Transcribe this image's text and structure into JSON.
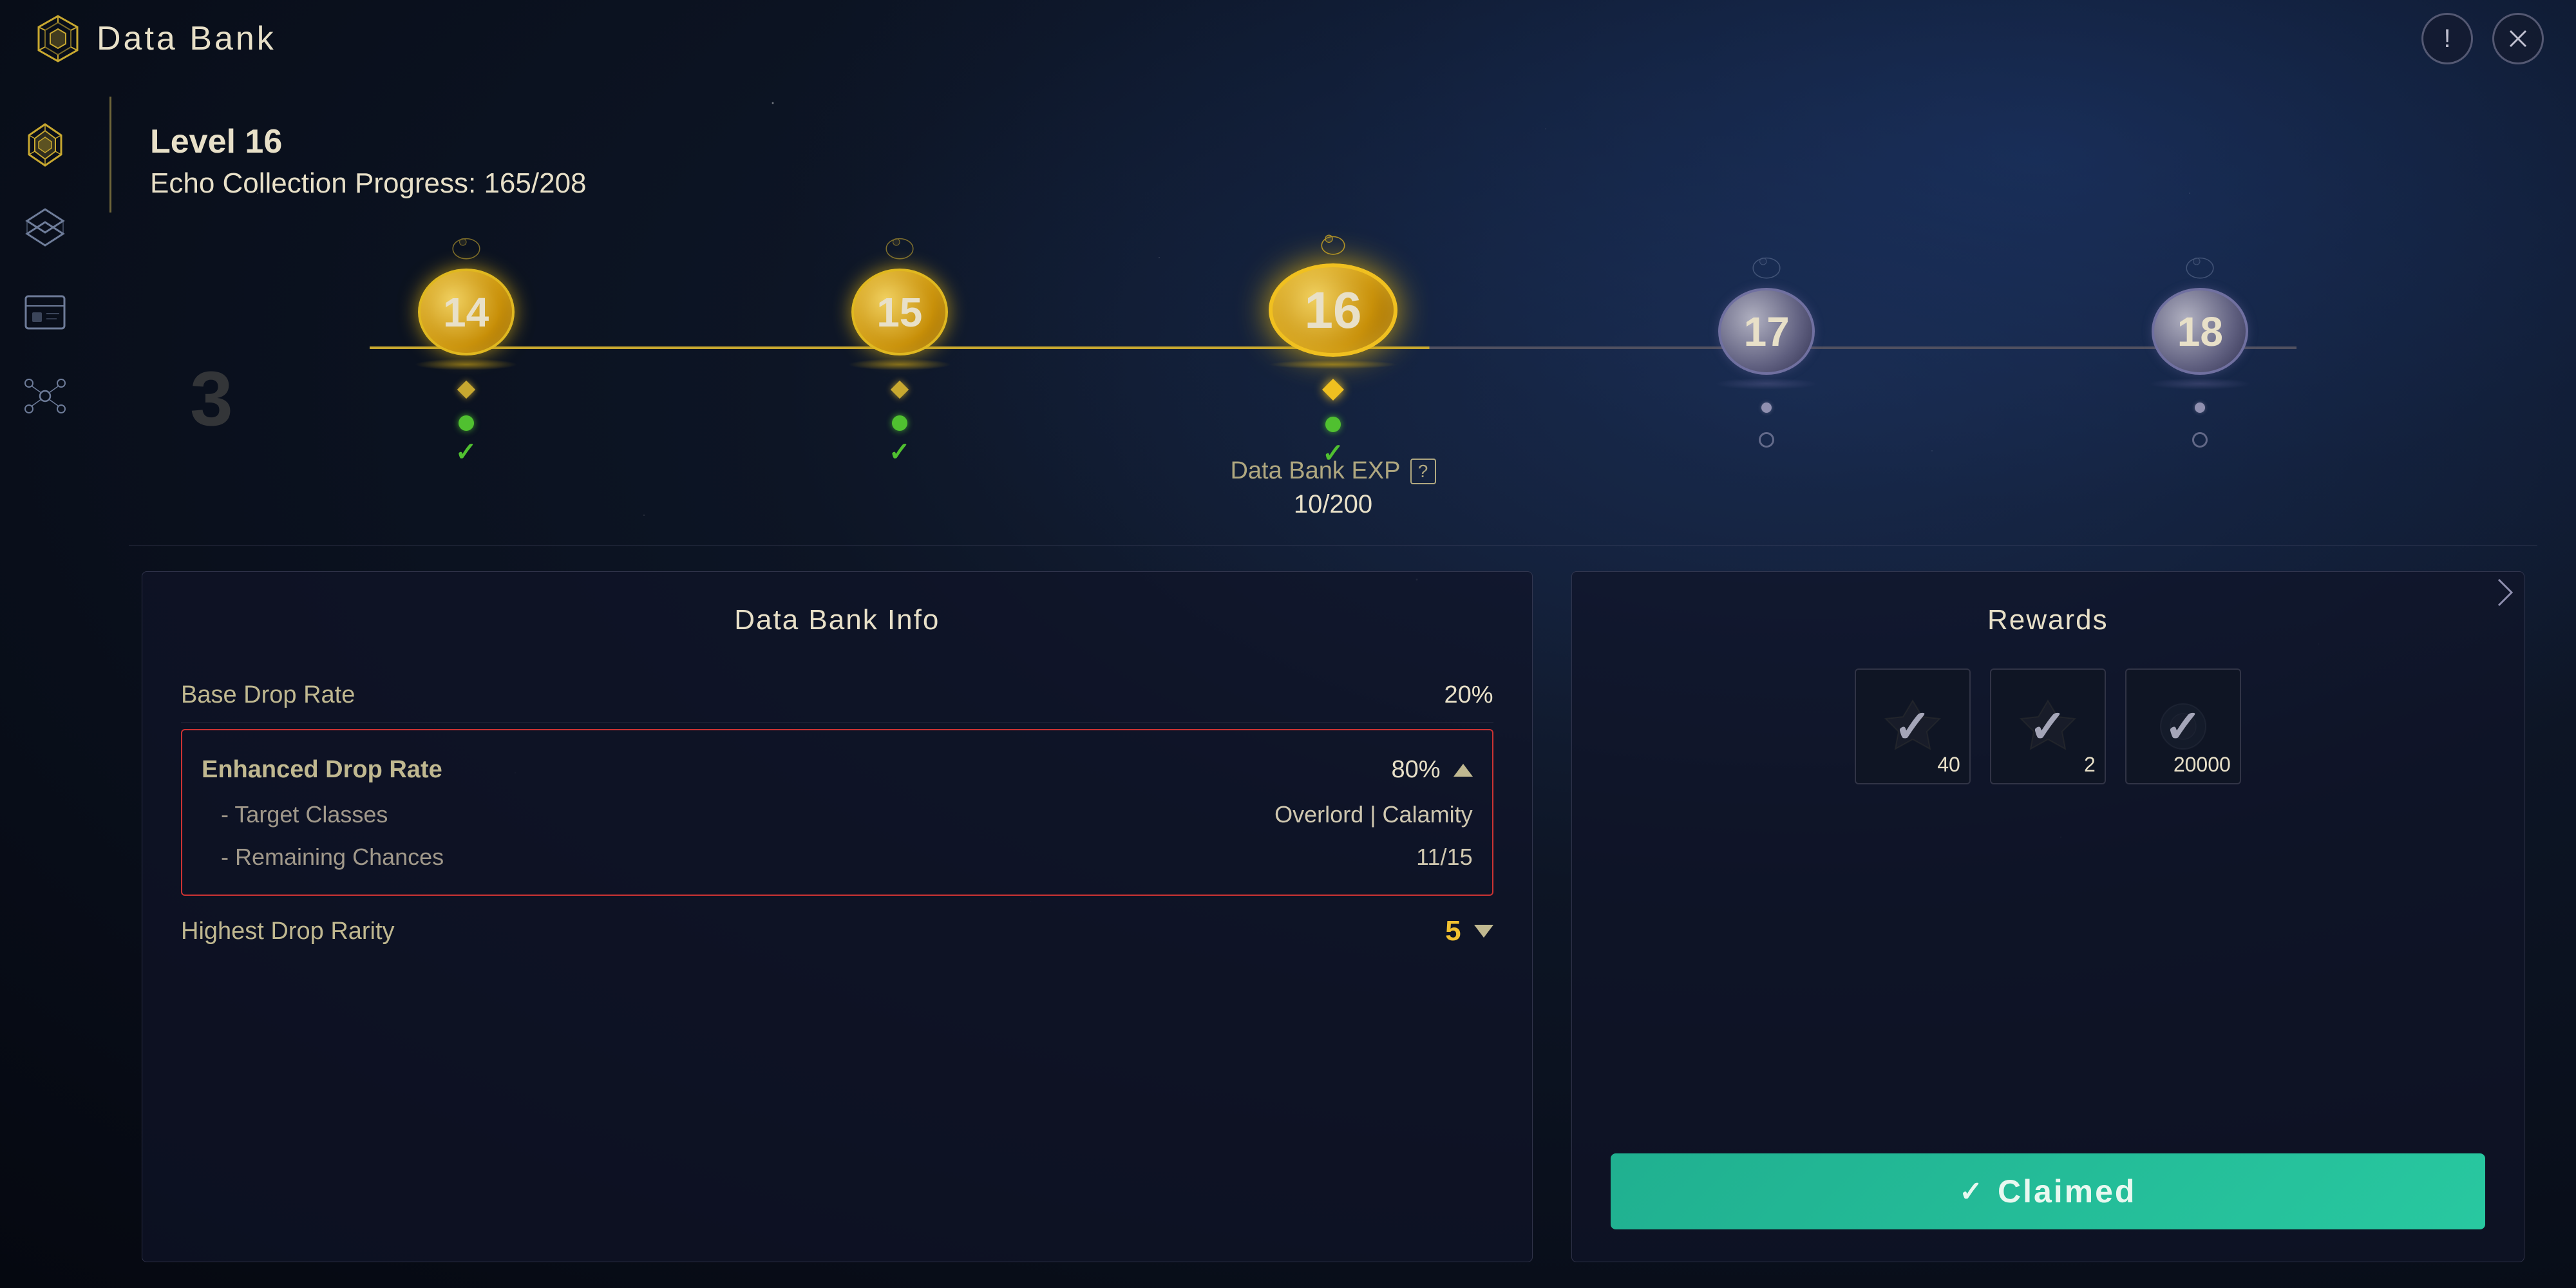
{
  "app": {
    "title": "Data Bank",
    "close_label": "×",
    "info_label": "!"
  },
  "level": {
    "current": "Level 16",
    "progress_label": "Echo Collection Progress: 165/208"
  },
  "milestones": [
    {
      "number": "14",
      "type": "gold",
      "claimed": true
    },
    {
      "number": "15",
      "type": "gold",
      "claimed": true
    },
    {
      "number": "16",
      "type": "gold-large",
      "claimed": true,
      "current": true
    },
    {
      "number": "17",
      "type": "silver",
      "claimed": false
    },
    {
      "number": "18",
      "type": "silver",
      "claimed": false
    }
  ],
  "exp": {
    "label": "Data Bank EXP",
    "value": "10/200"
  },
  "info_panel": {
    "title": "Data Bank Info",
    "rows": [
      {
        "label": "Base Drop Rate",
        "value": "20%",
        "color": "normal"
      },
      {
        "label": "Enhanced Drop Rate",
        "value": "80%",
        "expanded": true,
        "sub_rows": [
          {
            "label": "- Target Classes",
            "value": "Overlord | Calamity"
          },
          {
            "label": "- Remaining Chances",
            "value": "11/15"
          }
        ]
      },
      {
        "label": "Highest Drop Rarity",
        "value": "5",
        "color": "yellow",
        "has_chevron": true
      }
    ]
  },
  "rewards_panel": {
    "title": "Rewards",
    "items": [
      {
        "count": "40",
        "type": "item1"
      },
      {
        "count": "2",
        "type": "item2"
      },
      {
        "count": "20000",
        "type": "item3"
      }
    ],
    "claimed_label": "Claimed",
    "claimed_check": "✓"
  },
  "sidebar": {
    "items": [
      {
        "label": "crystal-icon"
      },
      {
        "label": "layers-icon"
      },
      {
        "label": "card-icon"
      },
      {
        "label": "network-icon"
      }
    ]
  }
}
